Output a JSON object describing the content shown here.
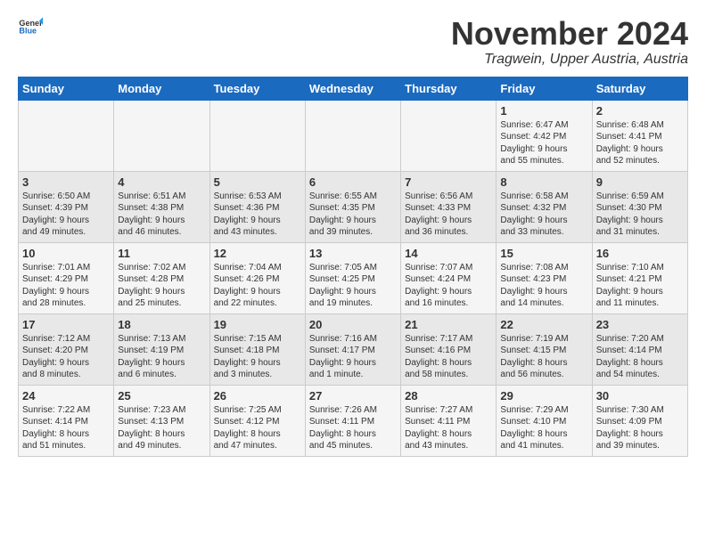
{
  "logo": {
    "general": "General",
    "blue": "Blue"
  },
  "header": {
    "month": "November 2024",
    "location": "Tragwein, Upper Austria, Austria"
  },
  "weekdays": [
    "Sunday",
    "Monday",
    "Tuesday",
    "Wednesday",
    "Thursday",
    "Friday",
    "Saturday"
  ],
  "weeks": [
    [
      {
        "day": "",
        "info": ""
      },
      {
        "day": "",
        "info": ""
      },
      {
        "day": "",
        "info": ""
      },
      {
        "day": "",
        "info": ""
      },
      {
        "day": "",
        "info": ""
      },
      {
        "day": "1",
        "info": "Sunrise: 6:47 AM\nSunset: 4:42 PM\nDaylight: 9 hours\nand 55 minutes."
      },
      {
        "day": "2",
        "info": "Sunrise: 6:48 AM\nSunset: 4:41 PM\nDaylight: 9 hours\nand 52 minutes."
      }
    ],
    [
      {
        "day": "3",
        "info": "Sunrise: 6:50 AM\nSunset: 4:39 PM\nDaylight: 9 hours\nand 49 minutes."
      },
      {
        "day": "4",
        "info": "Sunrise: 6:51 AM\nSunset: 4:38 PM\nDaylight: 9 hours\nand 46 minutes."
      },
      {
        "day": "5",
        "info": "Sunrise: 6:53 AM\nSunset: 4:36 PM\nDaylight: 9 hours\nand 43 minutes."
      },
      {
        "day": "6",
        "info": "Sunrise: 6:55 AM\nSunset: 4:35 PM\nDaylight: 9 hours\nand 39 minutes."
      },
      {
        "day": "7",
        "info": "Sunrise: 6:56 AM\nSunset: 4:33 PM\nDaylight: 9 hours\nand 36 minutes."
      },
      {
        "day": "8",
        "info": "Sunrise: 6:58 AM\nSunset: 4:32 PM\nDaylight: 9 hours\nand 33 minutes."
      },
      {
        "day": "9",
        "info": "Sunrise: 6:59 AM\nSunset: 4:30 PM\nDaylight: 9 hours\nand 31 minutes."
      }
    ],
    [
      {
        "day": "10",
        "info": "Sunrise: 7:01 AM\nSunset: 4:29 PM\nDaylight: 9 hours\nand 28 minutes."
      },
      {
        "day": "11",
        "info": "Sunrise: 7:02 AM\nSunset: 4:28 PM\nDaylight: 9 hours\nand 25 minutes."
      },
      {
        "day": "12",
        "info": "Sunrise: 7:04 AM\nSunset: 4:26 PM\nDaylight: 9 hours\nand 22 minutes."
      },
      {
        "day": "13",
        "info": "Sunrise: 7:05 AM\nSunset: 4:25 PM\nDaylight: 9 hours\nand 19 minutes."
      },
      {
        "day": "14",
        "info": "Sunrise: 7:07 AM\nSunset: 4:24 PM\nDaylight: 9 hours\nand 16 minutes."
      },
      {
        "day": "15",
        "info": "Sunrise: 7:08 AM\nSunset: 4:23 PM\nDaylight: 9 hours\nand 14 minutes."
      },
      {
        "day": "16",
        "info": "Sunrise: 7:10 AM\nSunset: 4:21 PM\nDaylight: 9 hours\nand 11 minutes."
      }
    ],
    [
      {
        "day": "17",
        "info": "Sunrise: 7:12 AM\nSunset: 4:20 PM\nDaylight: 9 hours\nand 8 minutes."
      },
      {
        "day": "18",
        "info": "Sunrise: 7:13 AM\nSunset: 4:19 PM\nDaylight: 9 hours\nand 6 minutes."
      },
      {
        "day": "19",
        "info": "Sunrise: 7:15 AM\nSunset: 4:18 PM\nDaylight: 9 hours\nand 3 minutes."
      },
      {
        "day": "20",
        "info": "Sunrise: 7:16 AM\nSunset: 4:17 PM\nDaylight: 9 hours\nand 1 minute."
      },
      {
        "day": "21",
        "info": "Sunrise: 7:17 AM\nSunset: 4:16 PM\nDaylight: 8 hours\nand 58 minutes."
      },
      {
        "day": "22",
        "info": "Sunrise: 7:19 AM\nSunset: 4:15 PM\nDaylight: 8 hours\nand 56 minutes."
      },
      {
        "day": "23",
        "info": "Sunrise: 7:20 AM\nSunset: 4:14 PM\nDaylight: 8 hours\nand 54 minutes."
      }
    ],
    [
      {
        "day": "24",
        "info": "Sunrise: 7:22 AM\nSunset: 4:14 PM\nDaylight: 8 hours\nand 51 minutes."
      },
      {
        "day": "25",
        "info": "Sunrise: 7:23 AM\nSunset: 4:13 PM\nDaylight: 8 hours\nand 49 minutes."
      },
      {
        "day": "26",
        "info": "Sunrise: 7:25 AM\nSunset: 4:12 PM\nDaylight: 8 hours\nand 47 minutes."
      },
      {
        "day": "27",
        "info": "Sunrise: 7:26 AM\nSunset: 4:11 PM\nDaylight: 8 hours\nand 45 minutes."
      },
      {
        "day": "28",
        "info": "Sunrise: 7:27 AM\nSunset: 4:11 PM\nDaylight: 8 hours\nand 43 minutes."
      },
      {
        "day": "29",
        "info": "Sunrise: 7:29 AM\nSunset: 4:10 PM\nDaylight: 8 hours\nand 41 minutes."
      },
      {
        "day": "30",
        "info": "Sunrise: 7:30 AM\nSunset: 4:09 PM\nDaylight: 8 hours\nand 39 minutes."
      }
    ]
  ]
}
